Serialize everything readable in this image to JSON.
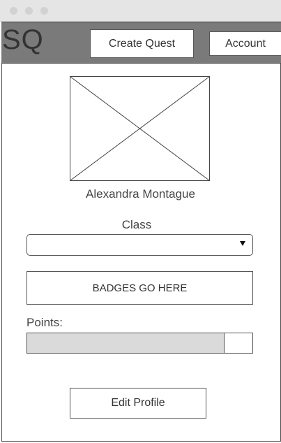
{
  "header": {
    "logo": "SQ",
    "create_quest_label": "Create Quest",
    "account_label": "Account"
  },
  "profile": {
    "avatar_icon": "image-placeholder-icon",
    "name": "Alexandra Montague"
  },
  "class_field": {
    "label": "Class",
    "selected_value": ""
  },
  "badges": {
    "placeholder": "BADGES GO HERE"
  },
  "points": {
    "label": "Points:",
    "progress_fraction": 0.875
  },
  "actions": {
    "edit_profile_label": "Edit Profile"
  },
  "colors": {
    "header_bg": "#7a7a7a",
    "progress_fill": "#dadada",
    "border": "#555555"
  }
}
